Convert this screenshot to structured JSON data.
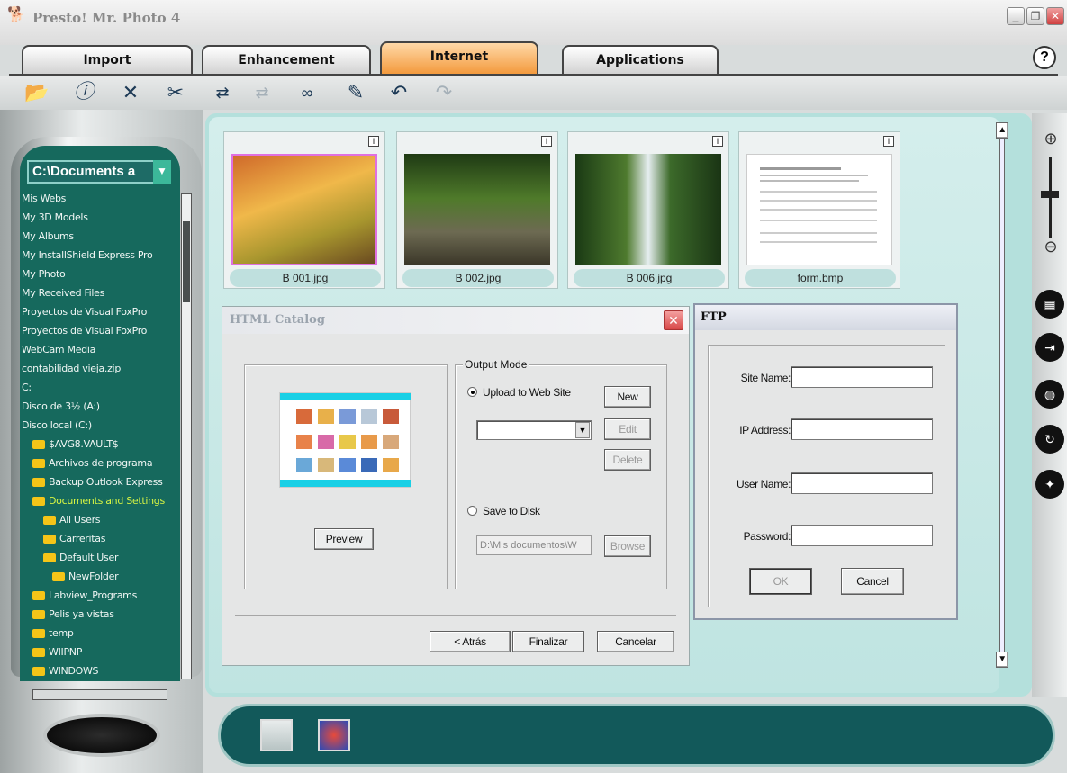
{
  "window": {
    "title": "Presto! Mr. Photo 4"
  },
  "tabs": [
    {
      "label": "Import"
    },
    {
      "label": "Enhancement"
    },
    {
      "label": "Internet"
    },
    {
      "label": "Applications"
    }
  ],
  "active_tab": "Internet",
  "help_label": "?",
  "tree": {
    "path": "C:\\Documents a",
    "items": [
      {
        "label": "Mis Webs",
        "folder": false
      },
      {
        "label": "My 3D Models",
        "folder": false
      },
      {
        "label": "My Albums",
        "folder": false
      },
      {
        "label": "My InstallShield Express Pro",
        "folder": false
      },
      {
        "label": "My Photo",
        "folder": false
      },
      {
        "label": "My Received Files",
        "folder": false
      },
      {
        "label": "Proyectos de Visual FoxPro",
        "folder": false
      },
      {
        "label": "Proyectos de Visual FoxPro",
        "folder": false
      },
      {
        "label": "WebCam Media",
        "folder": false
      },
      {
        "label": "contabilidad vieja.zip",
        "folder": false
      },
      {
        "label": "C:",
        "folder": false
      },
      {
        "label": "Disco de 3½ (A:)",
        "folder": false
      },
      {
        "label": "Disco local (C:)",
        "folder": false
      },
      {
        "label": "$AVG8.VAULT$",
        "folder": true
      },
      {
        "label": "Archivos de programa",
        "folder": true
      },
      {
        "label": "Backup Outlook Express",
        "folder": true
      },
      {
        "label": "Documents and Settings",
        "folder": true,
        "highlight": true
      },
      {
        "label": "All Users",
        "folder": true
      },
      {
        "label": "Carreritas",
        "folder": true
      },
      {
        "label": "Default User",
        "folder": true
      },
      {
        "label": "NewFolder",
        "folder": true
      },
      {
        "label": "Labview_Programs",
        "folder": true
      },
      {
        "label": "Pelis ya vistas",
        "folder": true
      },
      {
        "label": "temp",
        "folder": true
      },
      {
        "label": "WIIPNP",
        "folder": true
      },
      {
        "label": "WINDOWS",
        "folder": true
      }
    ]
  },
  "thumbnails": [
    {
      "caption": "B 001.jpg",
      "selected": true
    },
    {
      "caption": "B 002.jpg",
      "selected": false
    },
    {
      "caption": "B 006.jpg",
      "selected": false
    },
    {
      "caption": "form.bmp",
      "selected": false
    }
  ],
  "thumb_info": "i",
  "html_catalog": {
    "title": "HTML Catalog",
    "preview_button": "Preview",
    "output_mode": "Output Mode",
    "upload_option": "Upload to Web Site",
    "new_button": "New",
    "edit_button": "Edit",
    "delete_button": "Delete",
    "save_option": "Save to Disk",
    "save_path": "D:\\Mis documentos\\W",
    "browse_button": "Browse",
    "back_button": "< Atrás",
    "finish_button": "Finalizar",
    "cancel_button": "Cancelar",
    "close_label": "✕"
  },
  "ftp": {
    "title": "FTP",
    "site_name_label": "Site Name:",
    "ip_label": "IP Address:",
    "user_label": "User Name:",
    "password_label": "Password:",
    "ok_button": "OK",
    "cancel_button": "Cancel"
  },
  "colors": {
    "accent_tab": "#f39a3d",
    "tree_bg": "#16695d",
    "main_bg": "#bfe4e1",
    "tray_bg": "#12595a"
  },
  "icons": [
    "open-folder-icon",
    "info-icon",
    "delete-icon",
    "cut-icon",
    "convert-icon",
    "convert-disabled-icon",
    "glasses-icon",
    "pen-icon",
    "undo-icon",
    "redo-icon"
  ]
}
